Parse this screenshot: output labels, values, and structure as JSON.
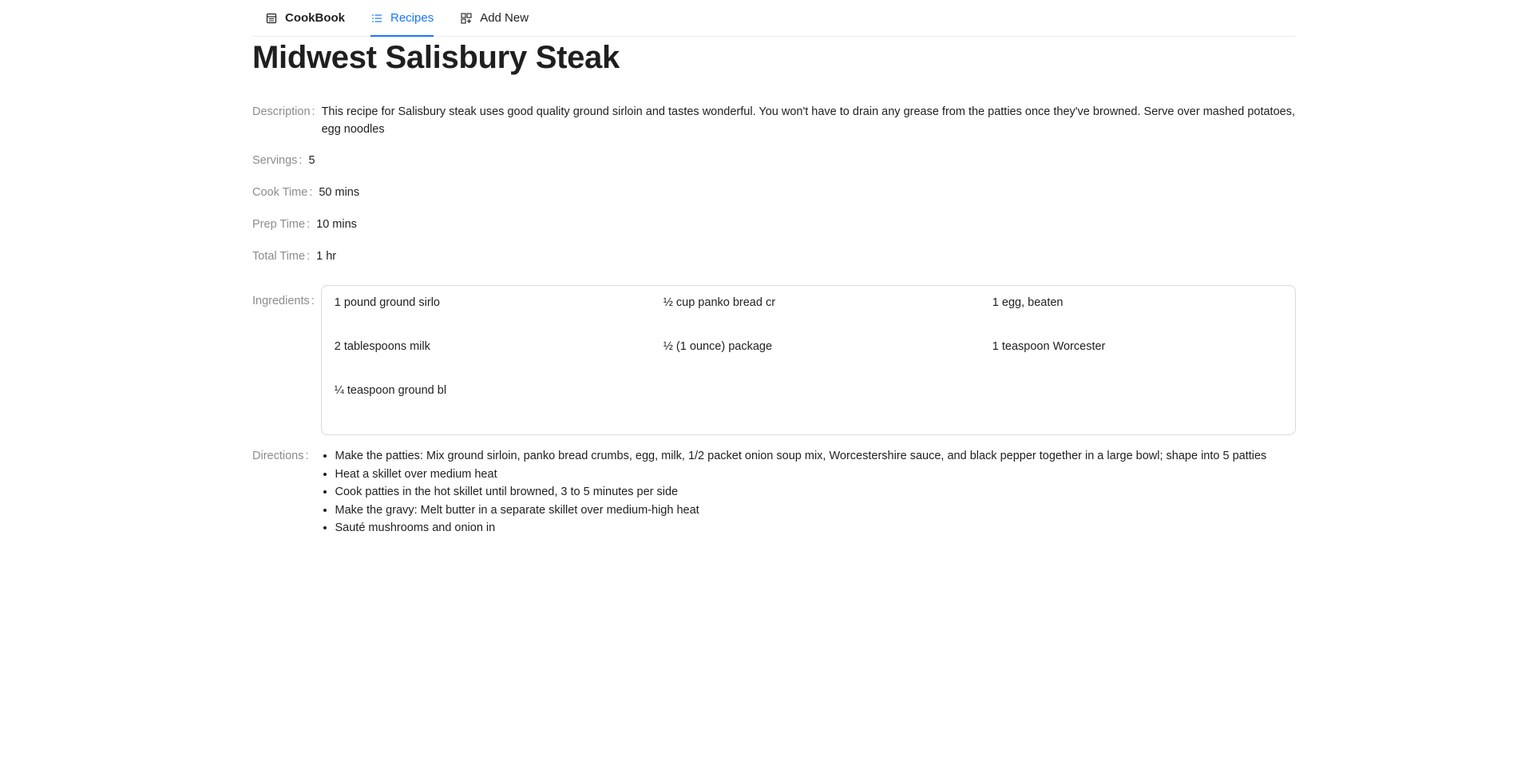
{
  "nav": {
    "brand": {
      "label": "CookBook",
      "icon": "cookbook-icon"
    },
    "items": [
      {
        "label": "Recipes",
        "icon": "list-icon",
        "active": true
      },
      {
        "label": "Add New",
        "icon": "add-grid-icon",
        "active": false
      }
    ]
  },
  "recipe": {
    "title": "Midwest Salisbury Steak",
    "fields": {
      "description": {
        "label": "Description",
        "value": "This recipe for Salisbury steak uses good quality ground sirloin and tastes wonderful. You won't have to drain any grease from the patties once they've browned. Serve over mashed potatoes, egg noodles"
      },
      "servings": {
        "label": "Servings",
        "value": "5"
      },
      "cook_time": {
        "label": "Cook Time",
        "value": "50 mins"
      },
      "prep_time": {
        "label": "Prep Time",
        "value": "10 mins"
      },
      "total_time": {
        "label": "Total Time",
        "value": "1 hr"
      },
      "ingredients": {
        "label": "Ingredients"
      },
      "directions": {
        "label": "Directions"
      }
    },
    "ingredients": [
      "1 pound ground sirlo",
      "½ cup panko bread cr",
      "1 egg, beaten",
      "2 tablespoons milk",
      "½ (1 ounce) package",
      "1 teaspoon Worcester",
      "¼ teaspoon ground bl"
    ],
    "directions": [
      "Make the patties: Mix ground sirloin, panko bread crumbs, egg, milk, 1/2 packet onion soup mix, Worcestershire sauce, and black pepper together in a large bowl; shape into 5 patties",
      "Heat a skillet over medium heat",
      "Cook patties in the hot skillet until browned, 3 to 5 minutes per side",
      "Make the gravy: Melt butter in a separate skillet over medium-high heat",
      "Sauté mushrooms and onion in"
    ],
    "colon": ":"
  },
  "colors": {
    "accent": "#1677ff",
    "label": "#8c8c8c",
    "text": "#1f1f1f",
    "border": "#d9d9d9"
  }
}
